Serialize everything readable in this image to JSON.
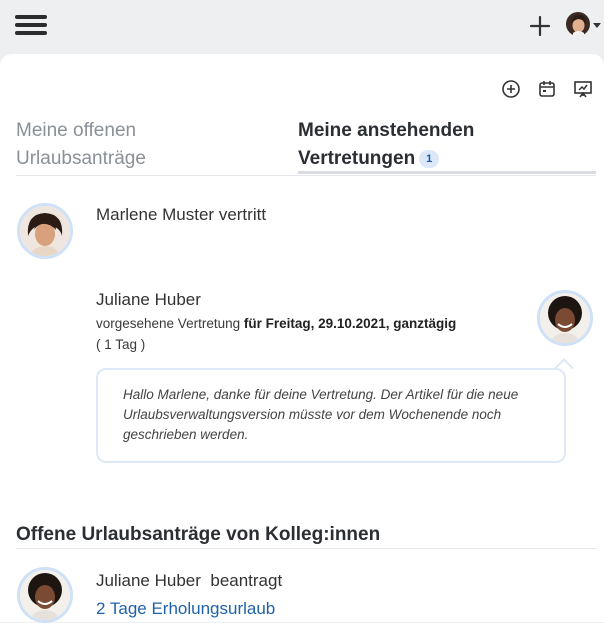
{
  "header": {
    "icons": [
      "menu-icon",
      "plus-icon",
      "user-avatar",
      "caret-down-icon"
    ]
  },
  "toolbar": {
    "icons": [
      "add-circle-icon",
      "calendar-icon",
      "presentation-icon"
    ]
  },
  "tabs": [
    {
      "line1": "Meine offenen",
      "line2": "Urlaubsanträge",
      "active": false
    },
    {
      "line1": "Meine anstehenden",
      "line2": "Vertretungen",
      "badge": "1",
      "active": true
    }
  ],
  "substitution": {
    "headline": "Marlene Muster vertritt",
    "requester_name": "Juliane Huber",
    "planned_prefix": "vorgesehene Vertretung",
    "planned_when": "für Freitag, 29.10.2021, ganztägig",
    "duration": "( 1 Tag )",
    "message": "Hallo Marlene, danke für deine Vertretung. Der Artikel für die neue Urlaubsverwaltungsversion müsste vor dem Wochenende noch geschrieben werden."
  },
  "colleagues_section": {
    "title": "Offene Urlaubsanträge von Kolleg:innen",
    "items": [
      {
        "name": "Juliane Huber",
        "action": "beantragt",
        "leave": "2 Tage Erholungsurlaub"
      }
    ]
  },
  "colors": {
    "accent": "#1f62a8",
    "badge_bg": "#dce8f8",
    "avatar_ring": "#cfe1f7",
    "background": "#eeeff1"
  }
}
